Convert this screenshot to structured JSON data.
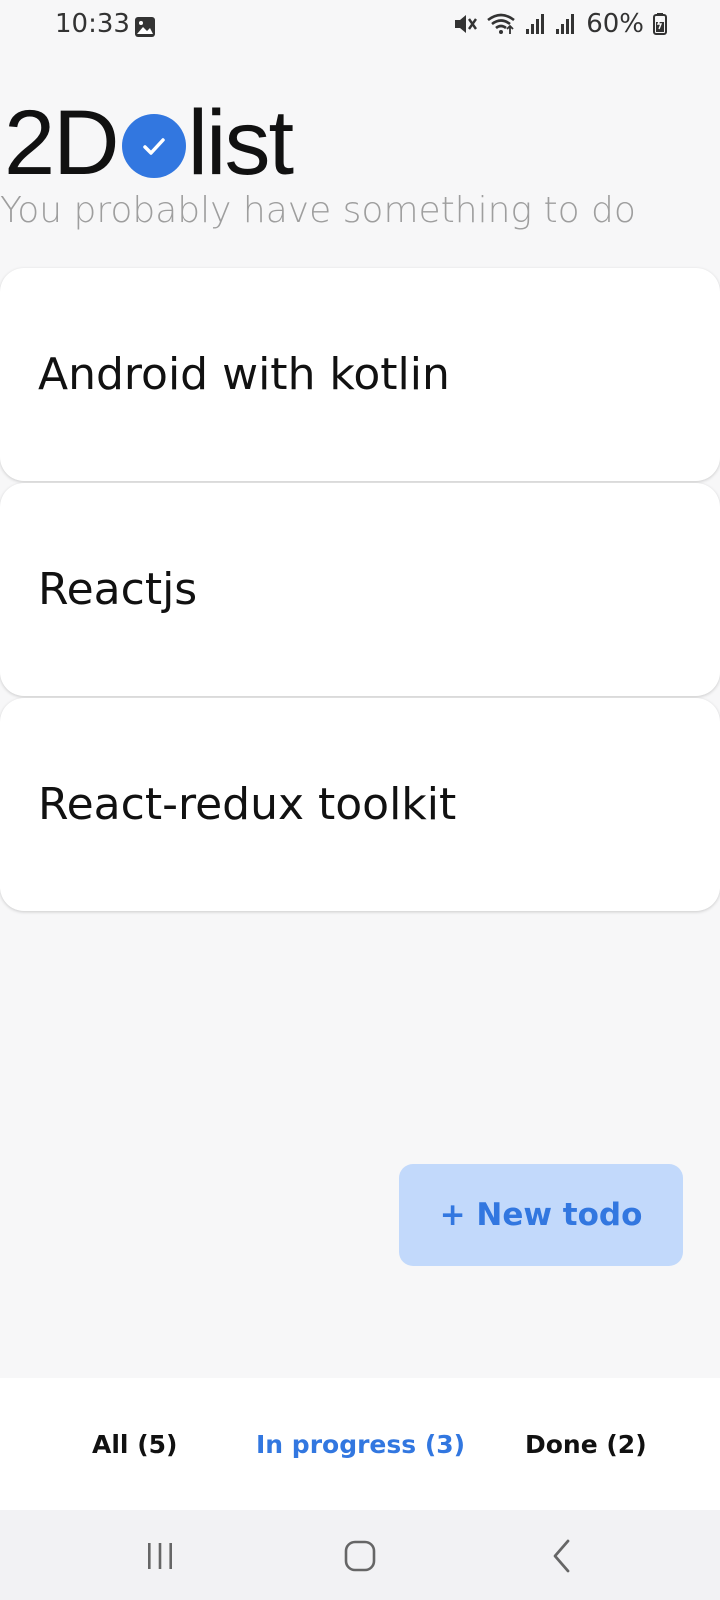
{
  "status_bar": {
    "time": "10:33",
    "battery": "60%",
    "icons": [
      "gallery-icon",
      "mute-icon",
      "wifi-icon",
      "signal-icon",
      "signal-icon",
      "battery-icon"
    ]
  },
  "app": {
    "logo_prefix": "2D",
    "logo_suffix": "list",
    "subtitle": "You probably have something to do"
  },
  "todos": [
    {
      "title": "Android with kotlin"
    },
    {
      "title": "Reactjs"
    },
    {
      "title": "React-redux toolkit"
    }
  ],
  "new_todo_label": "+ New todo",
  "tabs": [
    {
      "label": "All (5)",
      "active": false
    },
    {
      "label": "In progress (3)",
      "active": true
    },
    {
      "label": "Done (2)",
      "active": false
    }
  ],
  "colors": {
    "accent": "#3277e0",
    "button_bg": "#c2d9fb",
    "background": "#f7f7f8",
    "subtitle": "#9e9e9e"
  }
}
